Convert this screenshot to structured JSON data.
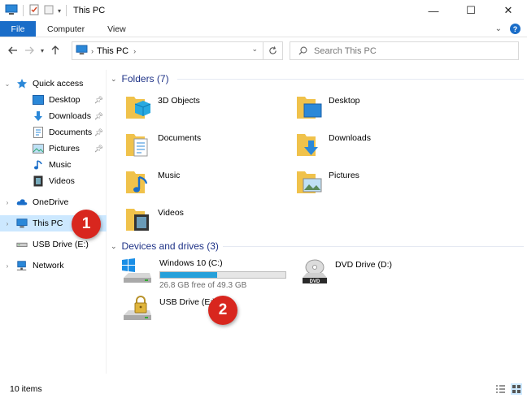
{
  "window": {
    "title": "This PC",
    "minimize": "—",
    "maximize": "☐",
    "close": "✕"
  },
  "ribbon": {
    "tabs": [
      "File",
      "Computer",
      "View"
    ]
  },
  "address": {
    "segment": "This PC"
  },
  "search": {
    "placeholder": "Search This PC"
  },
  "navpane": {
    "quick_access": "Quick access",
    "quick_items": [
      "Desktop",
      "Downloads",
      "Documents",
      "Pictures",
      "Music",
      "Videos"
    ],
    "onedrive": "OneDrive",
    "this_pc": "This PC",
    "usb": "USB Drive (E:)",
    "network": "Network"
  },
  "folders": {
    "header": "Folders (7)",
    "items": [
      "3D Objects",
      "Desktop",
      "Documents",
      "Downloads",
      "Music",
      "Pictures",
      "Videos"
    ]
  },
  "drives": {
    "header": "Devices and drives (3)",
    "windows": {
      "name": "Windows 10 (C:)",
      "free": "26.8 GB free of 49.3 GB",
      "used_fraction": 0.456
    },
    "dvd": {
      "name": "DVD Drive (D:)",
      "badge": "DVD"
    },
    "usb": {
      "name": "USB Drive (E:)"
    }
  },
  "callouts": [
    "1",
    "2"
  ],
  "status": {
    "count": "10 items"
  },
  "colors": {
    "accent": "#1a6dc8",
    "selected": "#cce8ff",
    "group_header": "#1e3287",
    "callout": "#d8261e",
    "drive_bar": "#26a0da",
    "folder": "#f0c24b"
  }
}
